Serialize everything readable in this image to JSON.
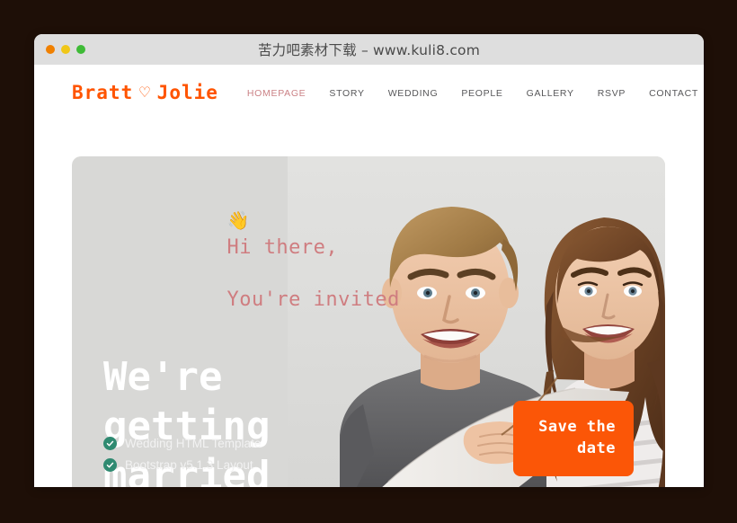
{
  "window": {
    "title": "苦力吧素材下载 – www.kuli8.com",
    "traffic_lights": [
      "close",
      "minimize",
      "maximize"
    ]
  },
  "site": {
    "logo": {
      "left": "Bratt",
      "heart": "♡",
      "right": "Jolie",
      "color": "#ff5400"
    },
    "nav": {
      "items": [
        {
          "label": "HOMEPAGE",
          "active": true
        },
        {
          "label": "STORY",
          "active": false
        },
        {
          "label": "WEDDING",
          "active": false
        },
        {
          "label": "PEOPLE",
          "active": false
        },
        {
          "label": "GALLERY",
          "active": false
        },
        {
          "label": "RSVP",
          "active": false
        },
        {
          "label": "CONTACT",
          "active": false
        }
      ],
      "active_color": "#cb8286",
      "inactive_color": "#58585a"
    },
    "hero": {
      "background": "#d8d8d6",
      "wave_emoji": "👋",
      "greeting_line1": "Hi there,",
      "greeting_line2": "You're invited",
      "greeting_color": "#cf7d80",
      "heading": "We're getting married",
      "heading_color": "#ffffff",
      "features": [
        {
          "label": "Wedding HTML Template",
          "icon": "check-circle-icon"
        },
        {
          "label": "Bootstrap v5.1.3 Layout",
          "icon": "check-circle-icon"
        }
      ],
      "feature_icon_color": "#2f8a71",
      "cta": {
        "line1": "Save the",
        "line2": "date",
        "color": "#fb5607"
      },
      "photo_alt": "Smiling young couple, woman hugging man from behind"
    }
  }
}
